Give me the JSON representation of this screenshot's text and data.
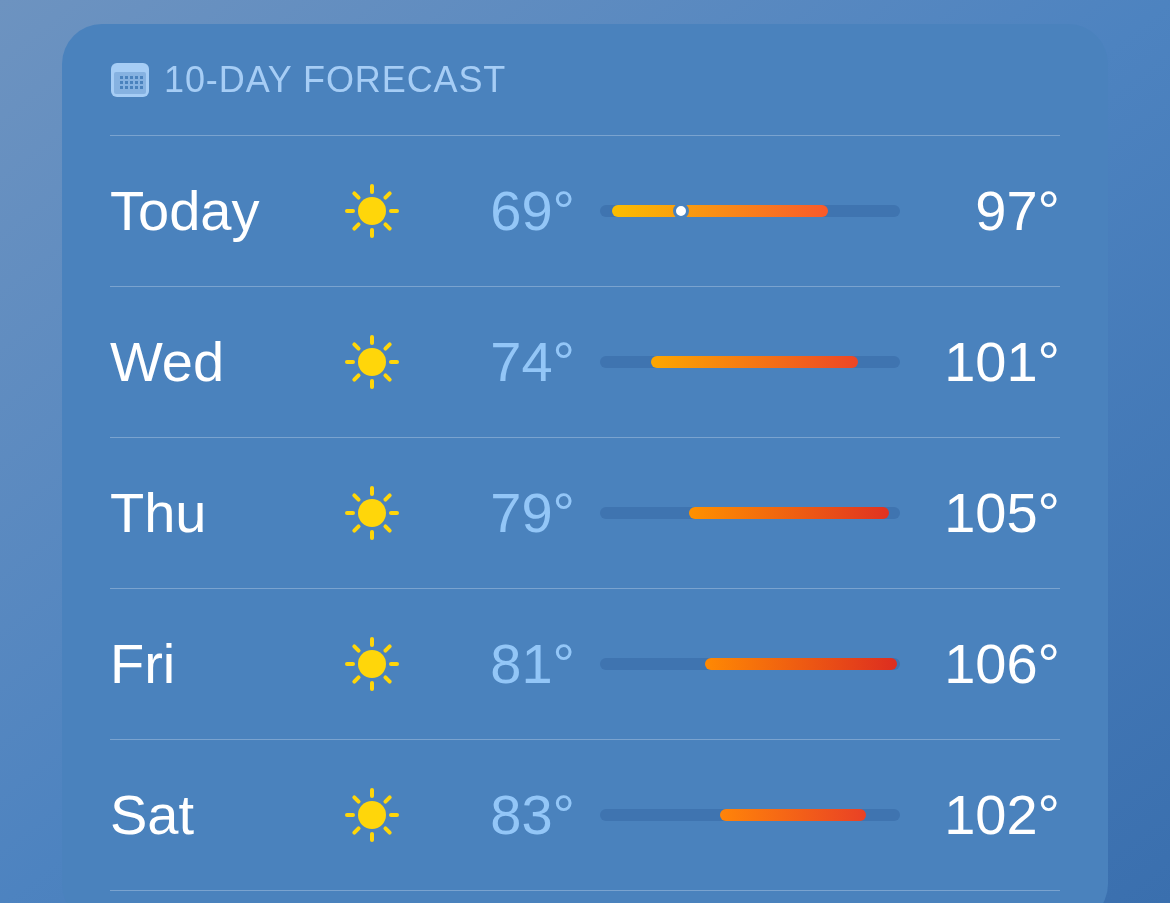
{
  "forecast": {
    "title": "10-DAY FORECAST",
    "days": [
      {
        "day": "Today",
        "low": "69°",
        "high": "97°",
        "now_marker": {
          "level": 0.27
        }
      },
      {
        "day": "Wed",
        "low": "74°",
        "high": "101°"
      },
      {
        "day": "Thu",
        "low": "79°",
        "high": "105°"
      },
      {
        "day": "Fri",
        "low": "81°",
        "high": "106°"
      },
      {
        "day": "Sat",
        "low": "83°",
        "high": "102°"
      }
    ]
  }
}
